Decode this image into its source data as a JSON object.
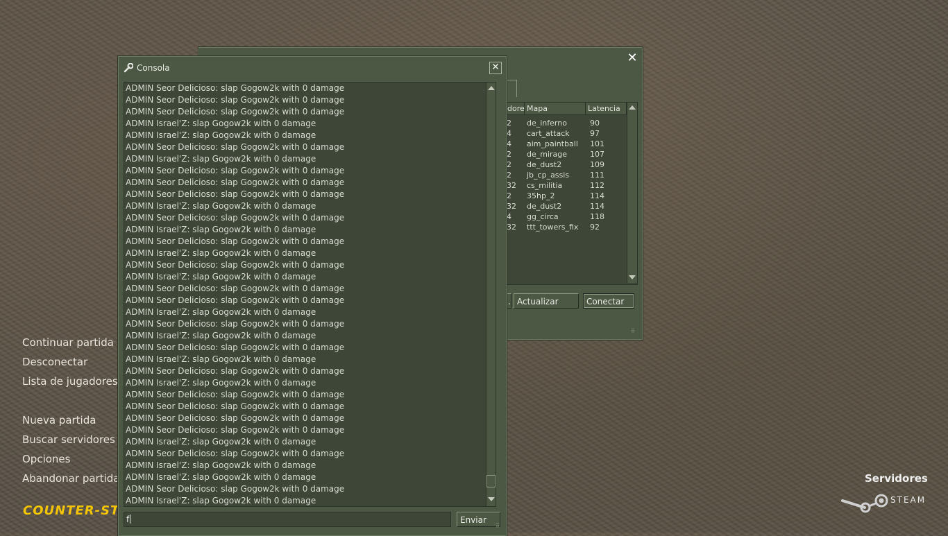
{
  "main_menu": {
    "items": [
      "Continuar partida",
      "Desconectar",
      "Lista de jugadores",
      "Nueva partida",
      "Buscar servidores",
      "Opciones",
      "Abandonar partida"
    ]
  },
  "logo_text": "COUNTER-STRIKE",
  "servidores_label": "Servidores",
  "steam_label": "STEAM",
  "server_browser": {
    "columns": [
      "dores",
      "Mapa",
      "Latencia"
    ],
    "rows": [
      {
        "players": "2",
        "map": "de_inferno",
        "latency": "90"
      },
      {
        "players": "4",
        "map": "cart_attack",
        "latency": "97"
      },
      {
        "players": "4",
        "map": "aim_paintball",
        "latency": "101"
      },
      {
        "players": "2",
        "map": "de_mirage",
        "latency": "107"
      },
      {
        "players": "2",
        "map": "de_dust2",
        "latency": "109"
      },
      {
        "players": "2",
        "map": "jb_cp_assis",
        "latency": "111"
      },
      {
        "players": "32",
        "map": "cs_militia",
        "latency": "112"
      },
      {
        "players": "2",
        "map": "35hp_2",
        "latency": "114"
      },
      {
        "players": "32",
        "map": "de_dust2",
        "latency": "114"
      },
      {
        "players": "4",
        "map": "gg_circa",
        "latency": "118"
      },
      {
        "players": "32",
        "map": "ttt_towers_fix",
        "latency": "92"
      }
    ],
    "partial_button": ".",
    "refresh_label": "Actualizar",
    "connect_label": "Conectar"
  },
  "console": {
    "title": "Consola",
    "lines": [
      "ADMIN Seor Delicioso: slap Gogow2k with 0 damage",
      "ADMIN Seor Delicioso: slap Gogow2k with 0 damage",
      "ADMIN Seor Delicioso: slap Gogow2k with 0 damage",
      "ADMIN Israel'Z: slap Gogow2k with 0 damage",
      "ADMIN Israel'Z: slap Gogow2k with 0 damage",
      "ADMIN Seor Delicioso: slap Gogow2k with 0 damage",
      "ADMIN Israel'Z: slap Gogow2k with 0 damage",
      "ADMIN Seor Delicioso: slap Gogow2k with 0 damage",
      "ADMIN Seor Delicioso: slap Gogow2k with 0 damage",
      "ADMIN Seor Delicioso: slap Gogow2k with 0 damage",
      "ADMIN Israel'Z: slap Gogow2k with 0 damage",
      "ADMIN Seor Delicioso: slap Gogow2k with 0 damage",
      "ADMIN Israel'Z: slap Gogow2k with 0 damage",
      "ADMIN Seor Delicioso: slap Gogow2k with 0 damage",
      "ADMIN Israel'Z: slap Gogow2k with 0 damage",
      "ADMIN Seor Delicioso: slap Gogow2k with 0 damage",
      "ADMIN Israel'Z: slap Gogow2k with 0 damage",
      "ADMIN Seor Delicioso: slap Gogow2k with 0 damage",
      "ADMIN Seor Delicioso: slap Gogow2k with 0 damage",
      "ADMIN Israel'Z: slap Gogow2k with 0 damage",
      "ADMIN Seor Delicioso: slap Gogow2k with 0 damage",
      "ADMIN Israel'Z: slap Gogow2k with 0 damage",
      "ADMIN Seor Delicioso: slap Gogow2k with 0 damage",
      "ADMIN Israel'Z: slap Gogow2k with 0 damage",
      "ADMIN Seor Delicioso: slap Gogow2k with 0 damage",
      "ADMIN Israel'Z: slap Gogow2k with 0 damage",
      "ADMIN Seor Delicioso: slap Gogow2k with 0 damage",
      "ADMIN Seor Delicioso: slap Gogow2k with 0 damage",
      "ADMIN Seor Delicioso: slap Gogow2k with 0 damage",
      "ADMIN Seor Delicioso: slap Gogow2k with 0 damage",
      "ADMIN Israel'Z: slap Gogow2k with 0 damage",
      "ADMIN Seor Delicioso: slap Gogow2k with 0 damage",
      "ADMIN Israel'Z: slap Gogow2k with 0 damage",
      "ADMIN Israel'Z: slap Gogow2k with 0 damage",
      "ADMIN Seor Delicioso: slap Gogow2k with 0 damage",
      "ADMIN Israel'Z: slap Gogow2k with 0 damage"
    ],
    "input_value": "f",
    "send_label": "Enviar"
  }
}
